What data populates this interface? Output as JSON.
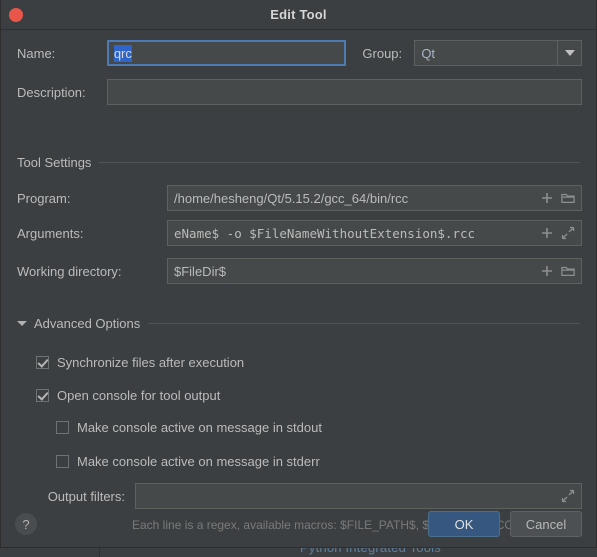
{
  "background": {
    "caption": "Python Integrated Tools"
  },
  "dialog": {
    "title": "Edit Tool",
    "close_icon": "close-icon"
  },
  "form": {
    "name": {
      "label": "Name:",
      "value": "qrc",
      "selected_text": "qrc",
      "focused": true
    },
    "group": {
      "label": "Group:",
      "value": "Qt",
      "arrow_icon": "chevron-down-icon"
    },
    "description": {
      "label": "Description:",
      "value": "",
      "placeholder": ""
    }
  },
  "tool_settings": {
    "header": "Tool Settings",
    "program": {
      "label": "Program:",
      "value": "/home/hesheng/Qt/5.15.2/gcc_64/bin/rcc",
      "icons": [
        "plus-icon",
        "folder-icon"
      ]
    },
    "arguments": {
      "label": "Arguments:",
      "value": "eName$ -o $FileNameWithoutExtension$.rcc",
      "icons": [
        "plus-icon",
        "expand-icon"
      ]
    },
    "working_directory": {
      "label": "Working directory:",
      "value": "$FileDir$",
      "icons": [
        "plus-icon",
        "folder-icon"
      ]
    }
  },
  "advanced_options": {
    "header": "Advanced Options",
    "expanded": true,
    "toggle_icon": "triangle-down-icon",
    "checkboxes": [
      {
        "label": "Synchronize files after execution",
        "checked": true
      },
      {
        "label": "Open console for tool output",
        "checked": true
      },
      {
        "label": "Make console active on message in stdout",
        "checked": false
      },
      {
        "label": "Make console active on message in stderr",
        "checked": false
      }
    ],
    "output_filters": {
      "label": "Output filters:",
      "value": "",
      "icons": [
        "expand-icon"
      ]
    },
    "hint": "Each line is a regex, available macros: $FILE_PATH$, $LINE$ and $COLU..."
  },
  "footer": {
    "help_label": "?",
    "ok_label": "OK",
    "cancel_label": "Cancel"
  },
  "colors": {
    "dialog_bg": "#3c3f41",
    "field_bg": "#45494a",
    "accent_focus": "#4d7ab5",
    "selection": "#2f65ca",
    "primary_button": "#365880",
    "close_button": "#e8564a",
    "text": "#bbbbbb"
  }
}
